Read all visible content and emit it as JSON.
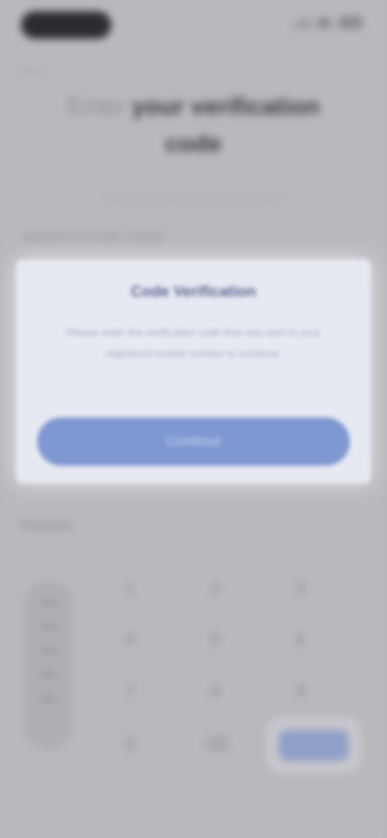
{
  "status_bar": {
    "time": "9:41"
  },
  "header": {
    "back_label": "Back",
    "title_accent": "Enter",
    "title_main": "your verification",
    "title_line2": "code",
    "subtitle": "We sent a code to your phone number"
  },
  "section": {
    "label": "VERIFICATION CODE",
    "label_2": "Resend"
  },
  "dialog": {
    "title": "Code Verification",
    "body": "Please enter the verification code that was sent to your registered mobile number to continue.",
    "button_label": "Continue"
  },
  "keypad": {
    "keys": [
      "1",
      "2",
      "3",
      "4",
      "5",
      "6",
      "7",
      "8",
      "9",
      "0",
      "⌫"
    ],
    "enter_label": "Done"
  },
  "colors": {
    "accent": "#7f98d2",
    "background": "#bab8bc",
    "dialog_bg": "#e7e9f2"
  }
}
